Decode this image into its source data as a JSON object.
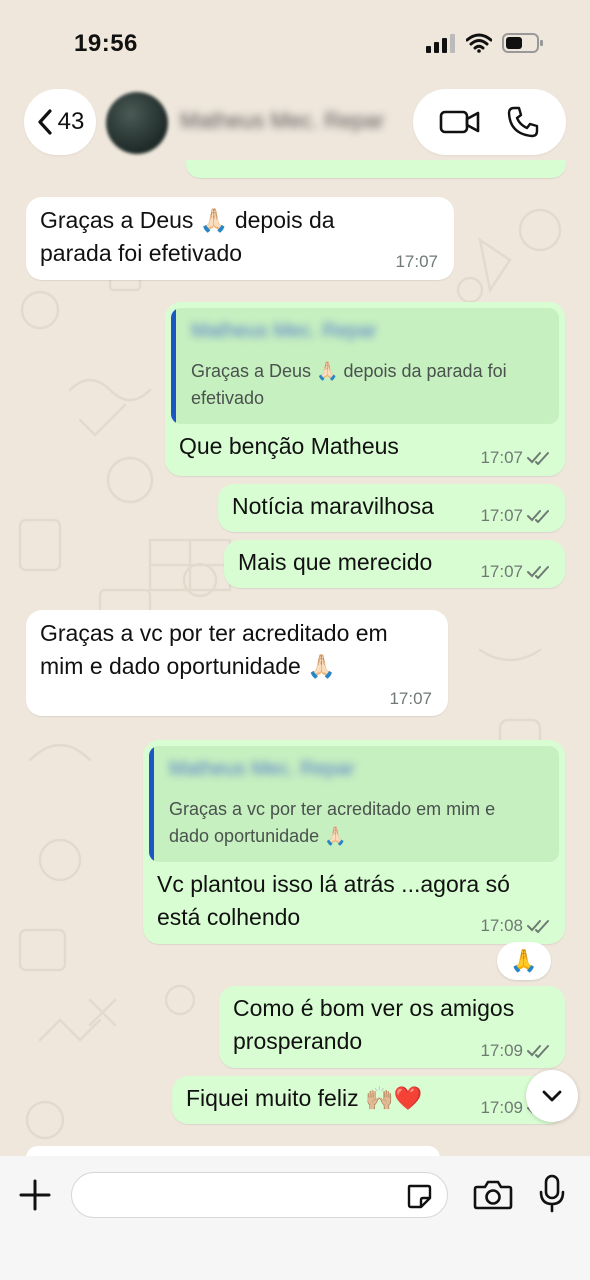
{
  "status_bar": {
    "time": "19:56"
  },
  "header": {
    "back_count": "43",
    "contact_name": "Matheus Mec. Repar"
  },
  "messages": [
    {
      "direction": "in",
      "text": "Graças a Deus 🙏🏻 depois da\nparada foi efetivado",
      "time": "17:07"
    },
    {
      "direction": "out",
      "quote_name": "Matheus Mec. Repar",
      "quote_text": "Graças a Deus 🙏🏻 depois da parada foi\nefetivado",
      "text": "Que benção Matheus",
      "time": "17:07",
      "read": true
    },
    {
      "direction": "out",
      "text": "Notícia maravilhosa",
      "time": "17:07",
      "read": true
    },
    {
      "direction": "out",
      "text": "Mais que merecido",
      "time": "17:07",
      "read": true
    },
    {
      "direction": "in",
      "text": "Graças a vc por ter acreditado em\nmim e dado oportunidade 🙏🏻",
      "time": "17:07"
    },
    {
      "direction": "out",
      "quote_name": "Matheus Mec. Repar",
      "quote_text": "Graças a vc por ter acreditado em mim e\ndado oportunidade 🙏🏻",
      "text": "Vc plantou isso lá atrás ...agora só\nestá colhendo",
      "time": "17:08",
      "read": true
    },
    {
      "direction": "out",
      "text": "Como é bom ver os amigos\nprosperando",
      "time": "17:09",
      "read": true
    },
    {
      "direction": "out",
      "text": "Fiquei muito feliz 🙌🏼❤️",
      "time": "17:09",
      "read": true
    }
  ],
  "reaction": "🙏",
  "composer": {
    "placeholder": ""
  },
  "colors": {
    "outgoing_bubble": "#d8fdd2",
    "incoming_bubble": "#ffffff",
    "quote_bar": "#1a56c4",
    "background": "#efe7dc"
  }
}
